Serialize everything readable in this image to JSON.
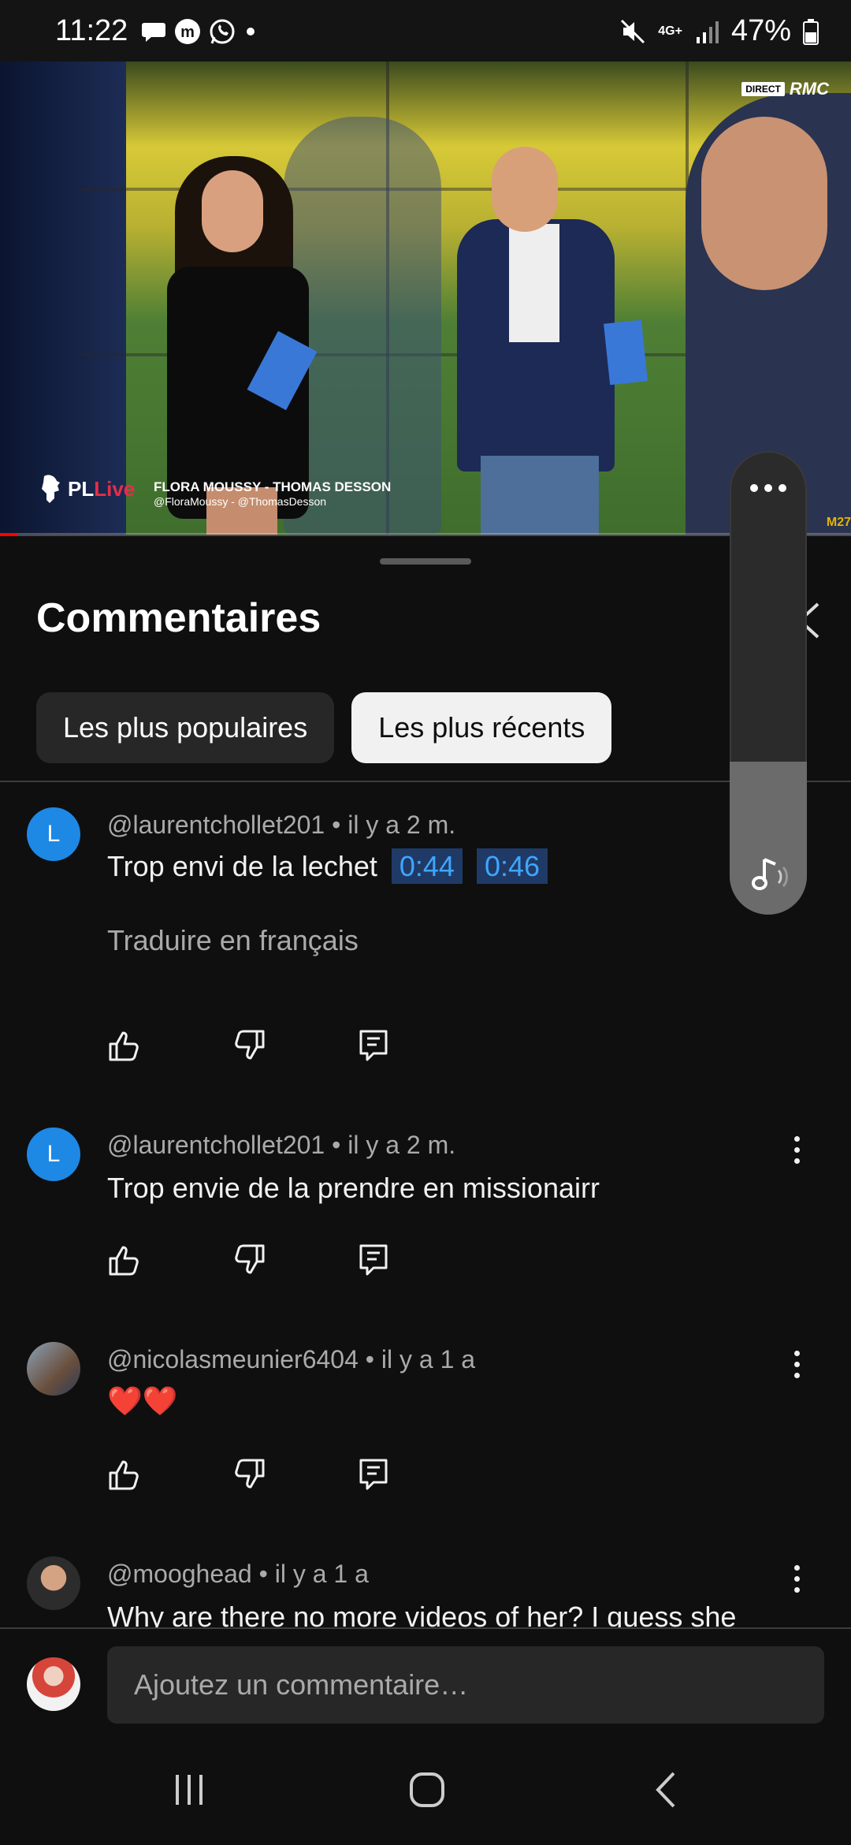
{
  "status_bar": {
    "time": "11:22",
    "network": "4G+",
    "battery": "47%",
    "notification_icons": [
      "chat-bubble-icon",
      "m-app-icon",
      "whatsapp-icon",
      "dot-icon"
    ]
  },
  "video": {
    "channel_badge_direct": "DIRECT",
    "channel_badge_name": "RMC",
    "logo_text_pl": "PL",
    "logo_text_live": "Live",
    "lower_third_names": "FLORA MOUSSY - THOMAS DESSON",
    "lower_third_handles": "@FloraMoussy - @ThomasDesson",
    "corner_text": "M27",
    "progress_fraction": 0.02
  },
  "comments_sheet": {
    "title": "Commentaires",
    "filters": [
      {
        "label": "Les plus populaires",
        "active": false
      },
      {
        "label": "Les plus récents",
        "active": true
      }
    ],
    "comments": [
      {
        "author": "@laurentchollet201",
        "age": "il y a 2 m.",
        "avatar_letter": "L",
        "text": "Trop envi de la lechet",
        "timestamps": [
          "0:44",
          "0:46"
        ],
        "translate_label": "Traduire en français"
      },
      {
        "author": "@laurentchollet201",
        "age": "il y a 2 m.",
        "avatar_letter": "L",
        "text": "Trop envie de la prendre en missionairr"
      },
      {
        "author": "@nicolasmeunier6404",
        "age": "il y a 1 a",
        "text": "❤️❤️"
      },
      {
        "author": "@mooghead",
        "age": "il y a 1 a",
        "text": "Why are there no more videos of her? I guess she"
      }
    ]
  },
  "composer": {
    "placeholder": "Ajoutez un commentaire…"
  },
  "colors": {
    "background": "#0f0f0f",
    "chip_active_bg": "#f1f1f1",
    "chip_inactive_bg": "#272727",
    "timestamp_link": "#3ea6ff",
    "avatar_letter_bg": "#1e88e5"
  },
  "volume_panel": {
    "level_fraction": 0.33
  }
}
